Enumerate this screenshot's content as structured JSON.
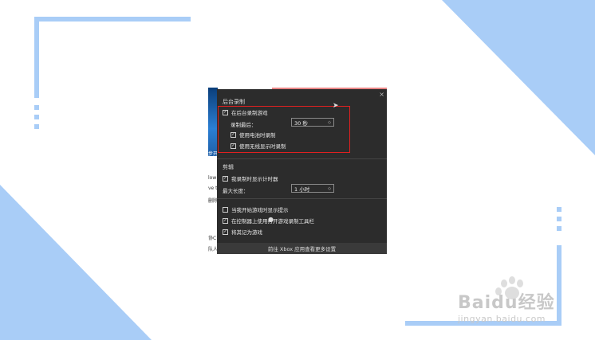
{
  "colors": {
    "accent_blue": "#a9cdf7",
    "panel_bg": "#2c2c2c",
    "highlight_red": "#e02020"
  },
  "panel": {
    "close_glyph": "×",
    "background_recording": {
      "title": "后台录制",
      "record_in_background": "在后台录制游戏",
      "record_last_label": "录制最后：",
      "record_last_value": "30 秒",
      "record_on_battery": "使用电池时录制",
      "record_wireless_display": "使用无线显示时录制"
    },
    "clip": {
      "title": "剪辑",
      "show_timer": "我录制时显示计时器",
      "max_length_label": "最大长度：",
      "max_length_value": "1 小时"
    },
    "other": {
      "show_tips": "当我开始游戏时显示提示",
      "controller_open": "在控制器上使用打开游戏录制工具栏",
      "remember_game": "将其记为游戏"
    },
    "footer": "前往 Xbox 应用查看更多设置"
  },
  "background_fragments": [
    "low",
    "ve t",
    "删除",
    "步开",
    "协C",
    "队人"
  ],
  "watermark": {
    "main": "Baidu经验",
    "sub": "jingyan.baidu.com"
  },
  "icons": [
    "checkbox-checked-icon",
    "checkbox-empty-icon",
    "chevron-updown-icon",
    "close-icon",
    "mouse-cursor-icon",
    "paw-logo-icon"
  ]
}
